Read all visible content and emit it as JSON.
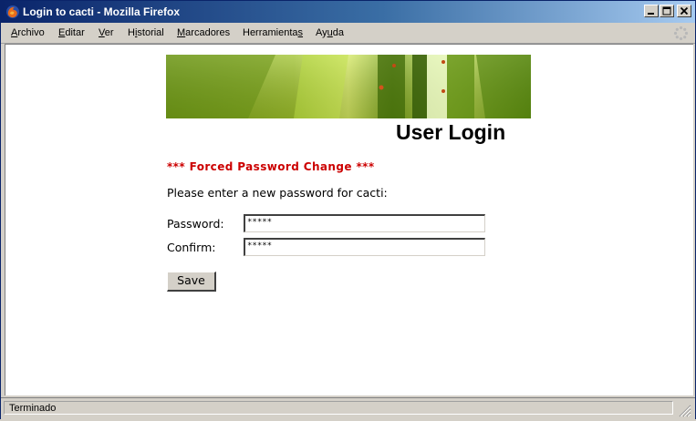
{
  "window": {
    "title": "Login to cacti - Mozilla Firefox"
  },
  "menu": {
    "items": [
      {
        "label": "Archivo",
        "accesskey_index": 0
      },
      {
        "label": "Editar",
        "accesskey_index": 0
      },
      {
        "label": "Ver",
        "accesskey_index": 0
      },
      {
        "label": "Historial",
        "accesskey_index": 1
      },
      {
        "label": "Marcadores",
        "accesskey_index": 0
      },
      {
        "label": "Herramientas",
        "accesskey_index": 11
      },
      {
        "label": "Ayuda",
        "accesskey_index": 2
      }
    ]
  },
  "page": {
    "heading": "User Login",
    "forced_notice": "*** Forced Password Change ***",
    "instructions": "Please enter a new password for cacti:",
    "password_label": "Password:",
    "password_value": "*****",
    "confirm_label": "Confirm:",
    "confirm_value": "*****",
    "save_label": "Save"
  },
  "status": {
    "text": "Terminado"
  },
  "colors": {
    "titlebar_start": "#0a246a",
    "titlebar_end": "#a6caf0",
    "notice_red": "#cc0000",
    "chrome_gray": "#d4d0c8"
  },
  "icons": [
    "firefox-icon",
    "minimize-icon",
    "maximize-icon",
    "close-icon",
    "throbber-icon",
    "resize-grip-icon"
  ]
}
